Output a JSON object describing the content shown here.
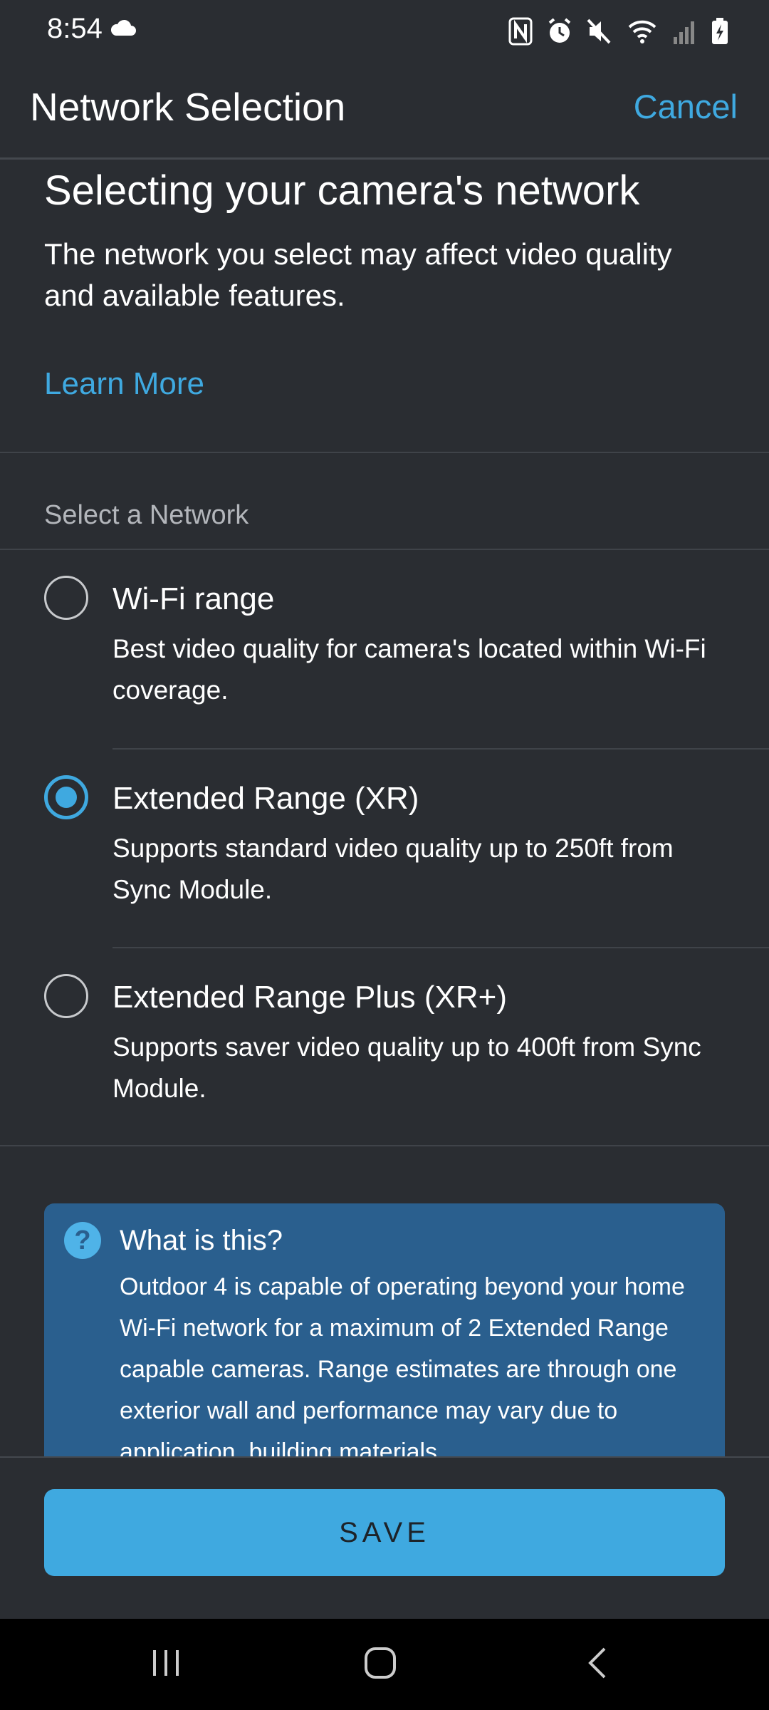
{
  "status_bar": {
    "time": "8:54",
    "icons": [
      "cloud-icon",
      "nfc-icon",
      "alarm-icon",
      "mute-icon",
      "wifi-icon",
      "signal-icon",
      "battery-charging-icon"
    ]
  },
  "header": {
    "title": "Network Selection",
    "cancel_label": "Cancel"
  },
  "intro": {
    "title": "Selecting your camera's network",
    "body": "The network you select may affect video quality and available features.",
    "learn_more": "Learn More"
  },
  "section_label": "Select a Network",
  "options": [
    {
      "title": "Wi-Fi range",
      "description": "Best video quality for camera's located within Wi-Fi coverage.",
      "selected": false
    },
    {
      "title": "Extended Range (XR)",
      "description": "Supports standard video quality up to 250ft from Sync Module.",
      "selected": true
    },
    {
      "title": "Extended Range Plus (XR+)",
      "description": "Supports saver video quality up to 400ft from Sync Module.",
      "selected": false
    }
  ],
  "info": {
    "icon_text": "?",
    "title": "What is this?",
    "body": "Outdoor 4 is capable of operating beyond your home Wi-Fi network for a maximum of 2 Extended Range capable cameras. Range estimates are through one exterior wall and performance may vary due to application, building materials."
  },
  "footer": {
    "save_label": "SAVE"
  },
  "colors": {
    "background": "#2a2d32",
    "accent": "#3fa9e0",
    "info_box": "#2a5f8e"
  }
}
